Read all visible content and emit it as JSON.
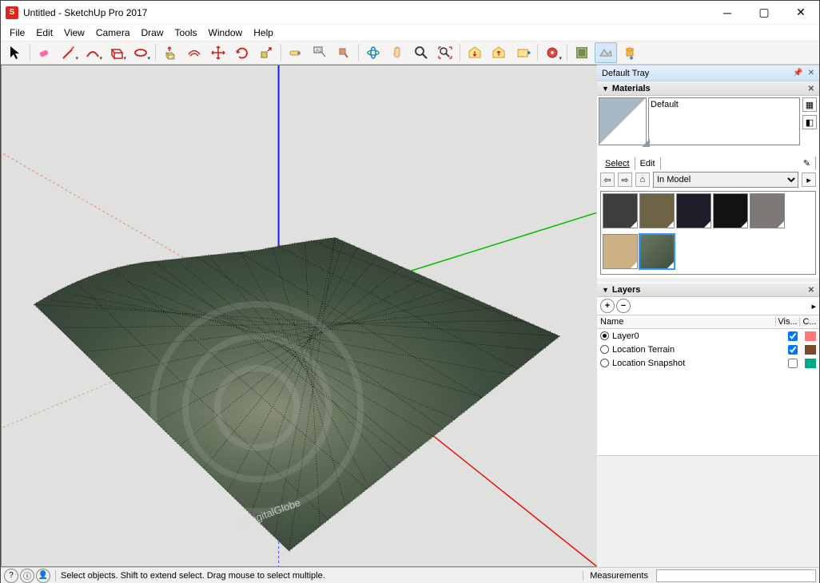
{
  "window": {
    "title": "Untitled - SketchUp Pro 2017"
  },
  "menu": [
    "File",
    "Edit",
    "View",
    "Camera",
    "Draw",
    "Tools",
    "Window",
    "Help"
  ],
  "tray": {
    "title": "Default Tray",
    "materials": {
      "title": "Materials",
      "current_name": "Default",
      "tabs": {
        "select": "Select",
        "edit": "Edit"
      },
      "browse_location": "In Model",
      "swatches": [
        {
          "name": "dark-gray",
          "color": "#3d3e3f"
        },
        {
          "name": "olive",
          "color": "#6f6345"
        },
        {
          "name": "navy-dark",
          "color": "#1d1d2a"
        },
        {
          "name": "black",
          "color": "#131313"
        },
        {
          "name": "gray",
          "color": "#7d7873"
        },
        {
          "name": "tan",
          "color": "#cbb183"
        },
        {
          "name": "terrain-texture",
          "color": "#6c7860"
        }
      ]
    },
    "layers": {
      "title": "Layers",
      "columns": {
        "name": "Name",
        "visible": "Vis...",
        "color": "C..."
      },
      "rows": [
        {
          "name": "Layer0",
          "current": true,
          "visible": true,
          "color": "#ff7777"
        },
        {
          "name": "Location Terrain",
          "current": false,
          "visible": true,
          "color": "#7a4a2a"
        },
        {
          "name": "Location Snapshot",
          "current": false,
          "visible": false,
          "color": "#00a88a"
        }
      ]
    }
  },
  "status": {
    "hint": "Select objects. Shift to extend select. Drag mouse to select multiple.",
    "measurements_label": "Measurements"
  }
}
